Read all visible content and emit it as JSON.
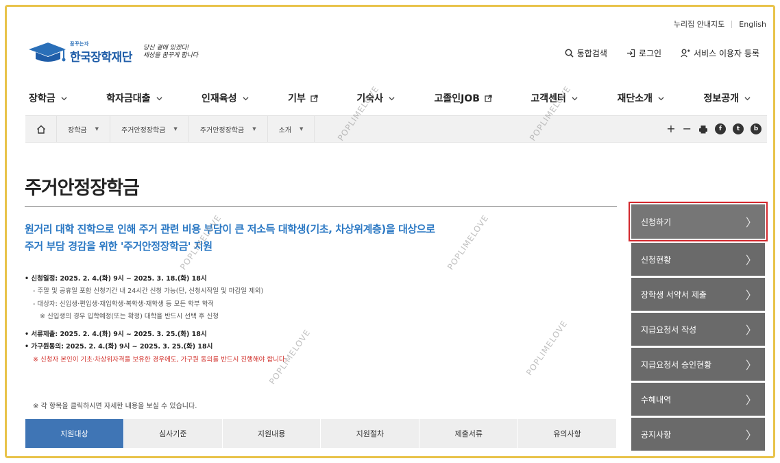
{
  "util_links": [
    "누리집 안내지도",
    "English"
  ],
  "logo": {
    "small": "꿈꾸는자",
    "name": "한국장학재단",
    "slogan": "당신 곁에 있겠다!\n세상을 꿈꾸게 합니다"
  },
  "header_actions": {
    "search": "통합검색",
    "login": "로그인",
    "register": "서비스 이용자 등록"
  },
  "gnb": [
    {
      "label": "장학금",
      "icon": "chevron-down-icon"
    },
    {
      "label": "학자금대출",
      "icon": "chevron-down-icon"
    },
    {
      "label": "인재육성",
      "icon": "chevron-down-icon"
    },
    {
      "label": "기부",
      "icon": "external-link-icon"
    },
    {
      "label": "기숙사",
      "icon": "chevron-down-icon"
    },
    {
      "label": "고졸인JOB",
      "icon": "external-link-icon"
    },
    {
      "label": "고객센터",
      "icon": "chevron-down-icon"
    },
    {
      "label": "재단소개",
      "icon": "chevron-down-icon"
    },
    {
      "label": "정보공개",
      "icon": "chevron-down-icon"
    }
  ],
  "breadcrumb": [
    "장학금",
    "주거안정장학금",
    "주거안정장학금",
    "소개"
  ],
  "page_title": "주거안정장학금",
  "lead": {
    "line1": "원거리 대학 진학으로 인해 주거 관련 비용 부담이 큰 저소득 대학생(기초, 차상위계층)을 대상으로",
    "line2": "주거 부담 경감을 위한 '주거안정장학금' 지원"
  },
  "details": {
    "apply_period": "• 신청일정: 2025. 2. 4.(화) 9시 ~ 2025. 3. 18.(화) 18시",
    "apply_note1": "- 주말 및 공휴일 포함 신청기간 내 24시간 신청 가능(단, 신청시작일 및 마감일 제외)",
    "apply_note2": "- 대상자: 신입생·편입생·재입학생·복학생·재학생 등 모든 학부 학적",
    "apply_note3": "※ 신입생의 경우 입학예정(또는 확정) 대학을 반드시 선택 후 신청",
    "docs_period": "• 서류제출: 2025. 2. 4.(화) 9시 ~ 2025. 3. 25.(화) 18시",
    "consent_period": "• 가구원동의: 2025. 2. 4.(화) 9시 ~ 2025. 3. 25.(화) 18시",
    "consent_note": "※ 신청자 본인이 기초·차상위자격을 보유한 경우에도, 가구원 동의를 반드시 진행해야 합니다."
  },
  "notice": "※ 각 항목을 클릭하시면 자세한 내용을 보실 수 있습니다.",
  "tabs": [
    "지원대상",
    "심사기준",
    "지원내용",
    "지원절차",
    "제출서류",
    "유의사항"
  ],
  "side_menu": [
    "신청하기",
    "신청현황",
    "장학생 서약서 제출",
    "지급요청서 작성",
    "지급요청서 승인현황",
    "수혜내역",
    "공지사항"
  ],
  "watermark": "POPLIMELOVE",
  "colors": {
    "accent_blue": "#2c79c4",
    "tab_active": "#3f75b5",
    "side_bg": "#6a6a6a",
    "highlight_red": "#d3282d",
    "frame": "#e8c34a",
    "notice_red": "#d2322d"
  }
}
